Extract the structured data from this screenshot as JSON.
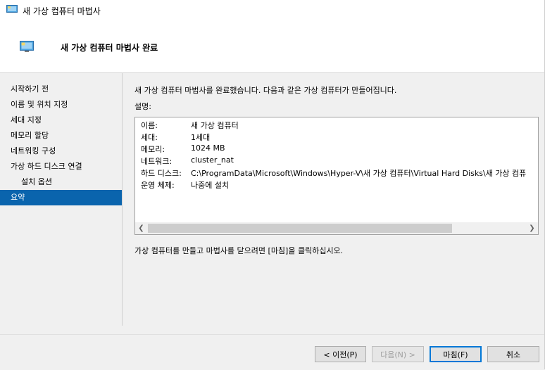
{
  "window": {
    "title": "새 가상 컴퓨터 마법사"
  },
  "header": {
    "title": "새 가상 컴퓨터 마법사 완료"
  },
  "sidebar": {
    "items": [
      {
        "label": "시작하기 전"
      },
      {
        "label": "이름 및 위치 지정"
      },
      {
        "label": "세대 지정"
      },
      {
        "label": "메모리 할당"
      },
      {
        "label": "네트워킹 구성"
      },
      {
        "label": "가상 하드 디스크 연결"
      },
      {
        "label": "설치 옵션"
      },
      {
        "label": "요약"
      }
    ],
    "active_index": 7
  },
  "content": {
    "intro": "새 가상 컴퓨터 마법사를 완료했습니다. 다음과 같은 가상 컴퓨터가 만들어집니다.",
    "desc_label": "설명:",
    "summary": [
      {
        "key": "이름:",
        "value": "새 가상 컴퓨터"
      },
      {
        "key": "세대:",
        "value": "1세대"
      },
      {
        "key": "메모리:",
        "value": "1024 MB"
      },
      {
        "key": "네트워크:",
        "value": "cluster_nat"
      },
      {
        "key": "하드 디스크:",
        "value": "C:\\ProgramData\\Microsoft\\Windows\\Hyper-V\\새 가상 컴퓨터\\Virtual Hard Disks\\새 가상 컴퓨"
      },
      {
        "key": "운영 체제:",
        "value": "나중에 설치"
      }
    ],
    "finish_note": "가상 컴퓨터를 만들고 마법사를 닫으려면 [마침]을 클릭하십시오."
  },
  "buttons": {
    "previous": "< 이전(P)",
    "next": "다음(N) >",
    "finish": "마침(F)",
    "cancel": "취소"
  },
  "icons": {
    "window": "hyperv-vm-icon",
    "header": "hyperv-vm-icon",
    "scroll_left": "chevron-left-icon",
    "scroll_right": "chevron-right-icon"
  },
  "colors": {
    "selection": "#0a64ad",
    "accent": "#0078d7"
  }
}
